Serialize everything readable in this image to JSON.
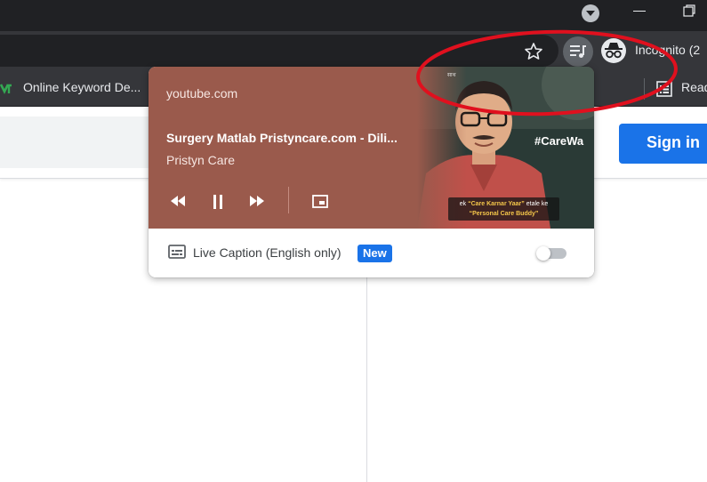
{
  "browser": {
    "profile_label": "Incognito (2",
    "accent_color": "#1a73e8"
  },
  "bookmarks": {
    "items": [
      {
        "label": "Online Keyword De..."
      },
      {
        "label": "Read"
      }
    ]
  },
  "page": {
    "signin_label": "Sign in"
  },
  "media_popup": {
    "origin": "youtube.com",
    "title": "Surgery Matlab Pristyncare.com - Dili...",
    "artist": "Pristyn Care",
    "artwork": {
      "hashtag": "#CareWa",
      "caption_line1_prefix": "ek ",
      "caption_line1_highlight": "“Care Karnar Yaar”",
      "caption_line1_suffix": " etale ke",
      "caption_line2": "“Personal Care Buddy”",
      "top_text": "साथ"
    },
    "live_caption_label": "Live Caption (English only)",
    "new_badge": "New",
    "card_color": "#9a5a4c"
  },
  "annotation": {
    "color": "#e0101e"
  }
}
